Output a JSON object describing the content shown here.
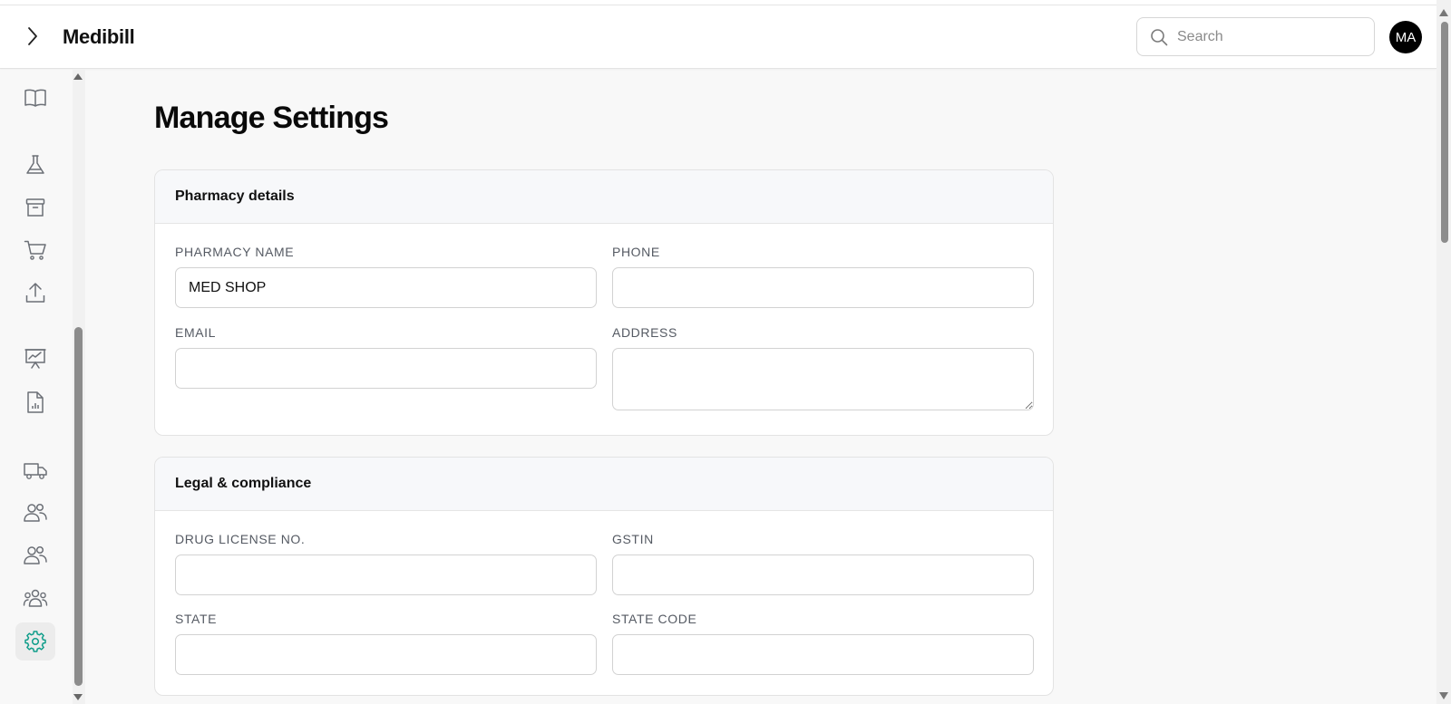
{
  "app": {
    "title": "Medibill"
  },
  "header": {
    "search_placeholder": "Search",
    "avatar_initials": "MA"
  },
  "sidebar": {
    "icons": [
      "book-icon",
      "flask-icon",
      "archive-icon",
      "cart-icon",
      "upload-icon",
      "presentation-chart-icon",
      "report-icon",
      "truck-icon",
      "users-icon",
      "user-group-icon",
      "team-icon",
      "settings-icon"
    ],
    "active": "settings-icon"
  },
  "page": {
    "title": "Manage Settings"
  },
  "pharmacy": {
    "heading": "Pharmacy details",
    "name_label": "PHARMACY NAME",
    "name_value": "MED SHOP",
    "phone_label": "PHONE",
    "phone_value": "",
    "email_label": "EMAIL",
    "email_value": "",
    "address_label": "ADDRESS",
    "address_value": ""
  },
  "legal": {
    "heading": "Legal & compliance",
    "license_label": "DRUG LICENSE NO.",
    "license_value": "",
    "gstin_label": "GSTIN",
    "gstin_value": "",
    "state_label": "STATE",
    "state_value": "",
    "state_code_label": "STATE CODE",
    "state_code_value": ""
  },
  "colors": {
    "accent": "#0f9d8a",
    "icon": "#6b6f76"
  }
}
